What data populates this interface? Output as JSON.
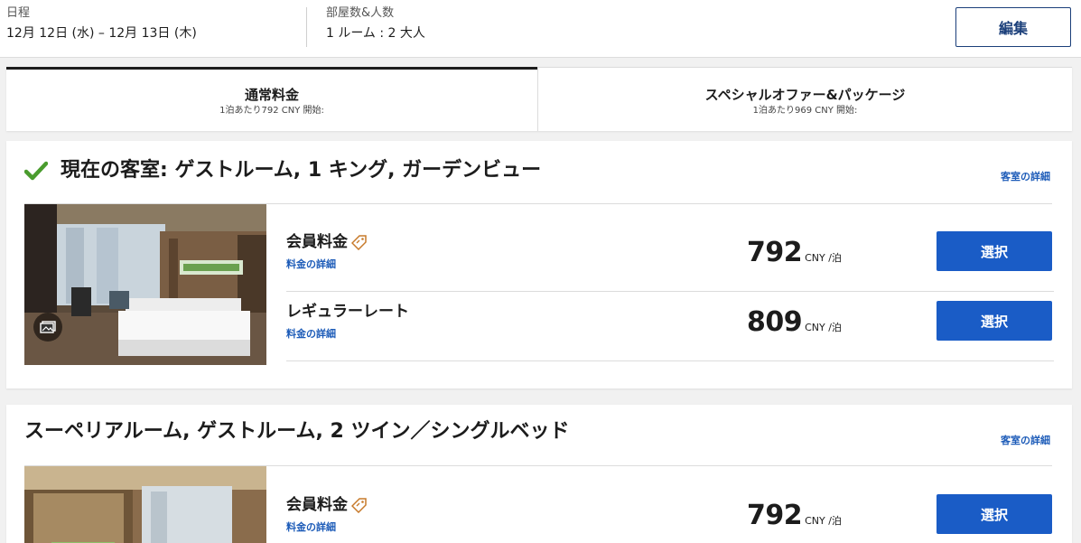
{
  "header": {
    "dates_label": "日程",
    "dates_value": "12月 12日 (水) – 12月 13日 (木)",
    "rooms_label": "部屋数&人数",
    "rooms_value": "1 ルーム : 2 大人",
    "edit_label": "編集"
  },
  "tabs": [
    {
      "title": "通常料金",
      "sub": "1泊あたり792 CNY 開始:",
      "active": true
    },
    {
      "title": "スペシャルオファー&パッケージ",
      "sub": "1泊あたり969 CNY 開始:",
      "active": false
    }
  ],
  "rooms": [
    {
      "title": "現在の客室: ゲストルーム, 1 キング, ガーデンビュー",
      "current": true,
      "detail_link": "客室の詳細",
      "rates": [
        {
          "name": "会員料金",
          "member_tag": true,
          "link": "料金の詳細",
          "price": "792",
          "unit": "CNY /泊",
          "button": "選択"
        },
        {
          "name": "レギュラーレート",
          "member_tag": false,
          "link": "料金の詳細",
          "price": "809",
          "unit": "CNY /泊",
          "button": "選択"
        }
      ]
    },
    {
      "title": "スーペリアルーム, ゲストルーム, 2 ツイン／シングルベッド",
      "current": false,
      "detail_link": "客室の詳細",
      "rates": [
        {
          "name": "会員料金",
          "member_tag": true,
          "link": "料金の詳細",
          "price": "792",
          "unit": "CNY /泊",
          "button": "選択"
        }
      ]
    }
  ],
  "colors": {
    "accent_blue": "#1a5cc6",
    "link_blue": "#1c5bb8",
    "check_green": "#4a9c2e",
    "tag_orange": "#c77a2a"
  }
}
